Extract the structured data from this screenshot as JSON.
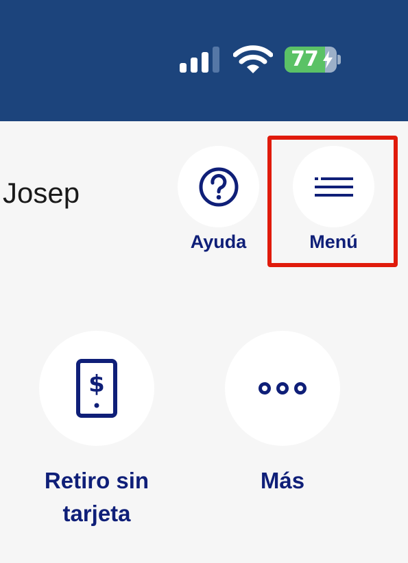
{
  "status_bar": {
    "battery_percent": "77",
    "battery_level": 0.77,
    "signal_bars_active": 3,
    "signal_bars_total": 4,
    "icons": [
      "signal-icon",
      "wifi-icon",
      "battery-icon",
      "charging-bolt-icon"
    ]
  },
  "header": {
    "user_name": "Josep"
  },
  "quick_actions": {
    "help": {
      "label": "Ayuda",
      "icon": "question-circle-icon"
    },
    "menu": {
      "label": "Menú",
      "icon": "hamburger-menu-icon"
    }
  },
  "tiles": {
    "cardless": {
      "label_line1": "Retiro sin",
      "label_line2": "tarjeta",
      "icon": "phone-dollar-icon"
    },
    "more": {
      "label": "Más",
      "icon": "more-dots-icon"
    }
  },
  "colors": {
    "header_bg": "#1c447c",
    "brand_navy": "#0f1f78",
    "highlight_red": "#e01b0c",
    "battery_green": "#5bc266",
    "page_bg": "#f6f6f6"
  }
}
